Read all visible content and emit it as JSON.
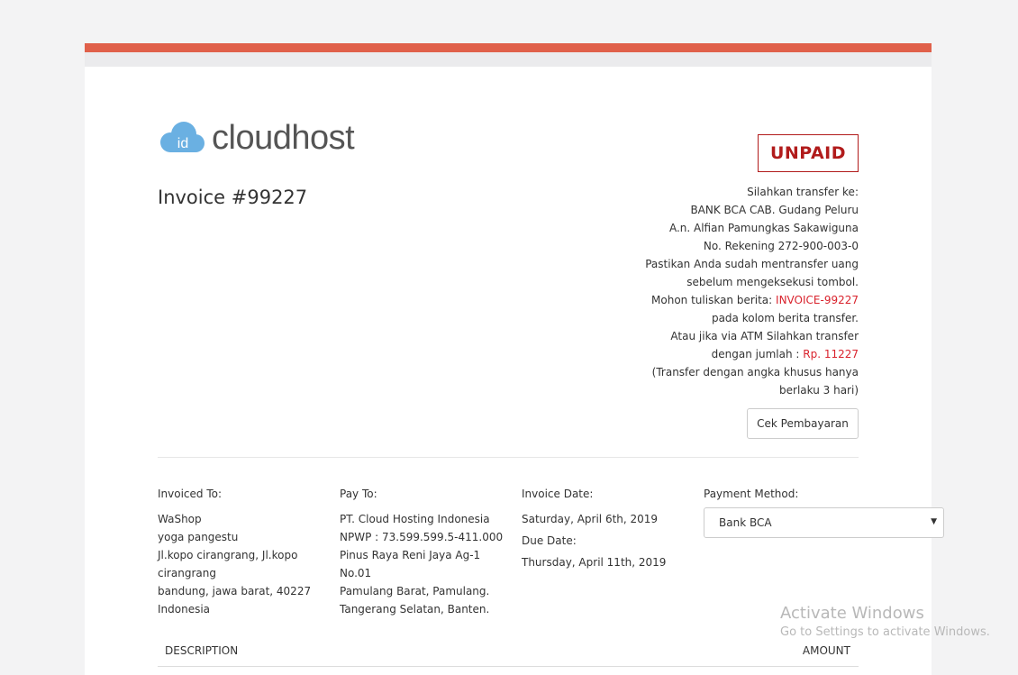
{
  "brand": {
    "logo_badge": "id",
    "logo_text": "cloudhost",
    "accent_color": "#e0604a",
    "cloud_color": "#6ab0e2"
  },
  "invoice": {
    "title": "Invoice #99227",
    "status": "UNPAID"
  },
  "transfer_info": {
    "l1": "Silahkan transfer ke:",
    "l2": "BANK BCA CAB. Gudang Peluru",
    "l3": "A.n. Alfian Pamungkas Sakawiguna",
    "l4": "No. Rekening 272-900-003-0",
    "l5": "Pastikan Anda sudah mentransfer uang",
    "l6": "sebelum mengeksekusi tombol.",
    "l7_prefix": "Mohon tuliskan berita: ",
    "l7_ref": "INVOICE-99227",
    "l8": "pada kolom berita transfer.",
    "l9": "Atau jika via ATM Silahkan transfer",
    "l10_prefix": "dengan jumlah : ",
    "l10_amount": "Rp. 11227",
    "l11": "(Transfer dengan angka khusus hanya",
    "l12": "berlaku 3 hari)"
  },
  "actions": {
    "check_payment": "Cek Pembayaran"
  },
  "invoiced_to": {
    "heading": "Invoiced To:",
    "lines": [
      "WaShop",
      "yoga pangestu",
      "Jl.kopo cirangrang, Jl.kopo",
      "cirangrang",
      "bandung, jawa barat, 40227",
      "Indonesia"
    ]
  },
  "pay_to": {
    "heading": "Pay To:",
    "lines": [
      "PT. Cloud Hosting Indonesia",
      "NPWP : 73.599.599.5-411.000",
      "Pinus Raya Reni Jaya Ag-1",
      "No.01",
      "Pamulang Barat, Pamulang.",
      "Tangerang Selatan, Banten."
    ]
  },
  "dates": {
    "invoice_heading": "Invoice Date:",
    "invoice_date": "Saturday, April 6th, 2019",
    "due_heading": "Due Date:",
    "due_date": "Thursday, April 11th, 2019"
  },
  "payment": {
    "heading": "Payment Method:",
    "selected": "Bank BCA"
  },
  "table": {
    "col_description": "DESCRIPTION",
    "col_amount": "AMOUNT"
  },
  "watermark": {
    "line1": "Activate Windows",
    "line2": "Go to Settings to activate Windows."
  }
}
